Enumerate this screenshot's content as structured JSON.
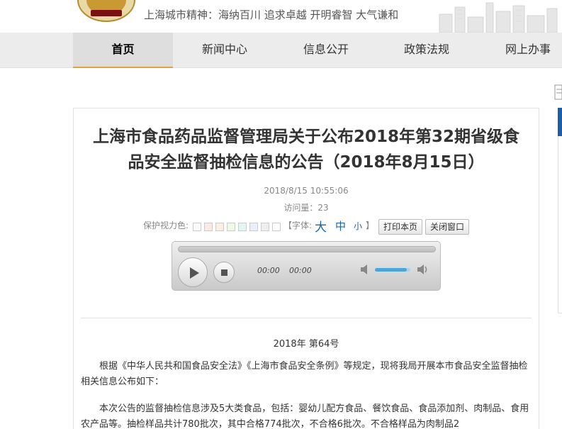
{
  "header": {
    "slogan": "上海城市精神：海纳百川  追求卓越  开明睿智  大气谦和"
  },
  "nav": {
    "items": [
      "首页",
      "新闻中心",
      "信息公开",
      "政策法规",
      "网上办事"
    ]
  },
  "article": {
    "title_line1": "上海市食品药品监督管理局关于公布2018年第32期省级食",
    "title_line2": "品安全监督抽检信息的公告（2018年8月15日）",
    "datetime": "2018/8/15 10:55:06",
    "visits": "访问量：23",
    "eye_care_label": "保护视力色:",
    "font_prefix": "【字体:",
    "font_big": "大",
    "font_mid": "中",
    "font_small": "小",
    "font_suffix": "】",
    "print_button": "打印本页",
    "close_button": "关闭窗口",
    "issue": "2018年  第64号",
    "para1": "根据《中华人民共和国食品安全法》《上海市食品安全条例》等规定，现将我局开展本市食品安全监督抽检相关信息公布如下：",
    "para2": "本次公告的监督抽检信息涉及5大类食品，包括：婴幼儿配方食品、餐饮食品、食品添加剂、肉制品、食用农产品等。抽检样品共计780批次，其中合格774批次，不合格6批次。不合格样品为肉制品2"
  },
  "player": {
    "current_time": "00:00",
    "duration": "00:00",
    "volume": 0.9
  },
  "colors": {
    "swatches": [
      "#fafafa",
      "#fde9e1",
      "#fcefdc",
      "#eff9df",
      "#e0f7f8",
      "#e8f1fb",
      "#eeeeee",
      "#ffffff"
    ],
    "accent": "#e0a23a",
    "link": "#1b64b0"
  }
}
